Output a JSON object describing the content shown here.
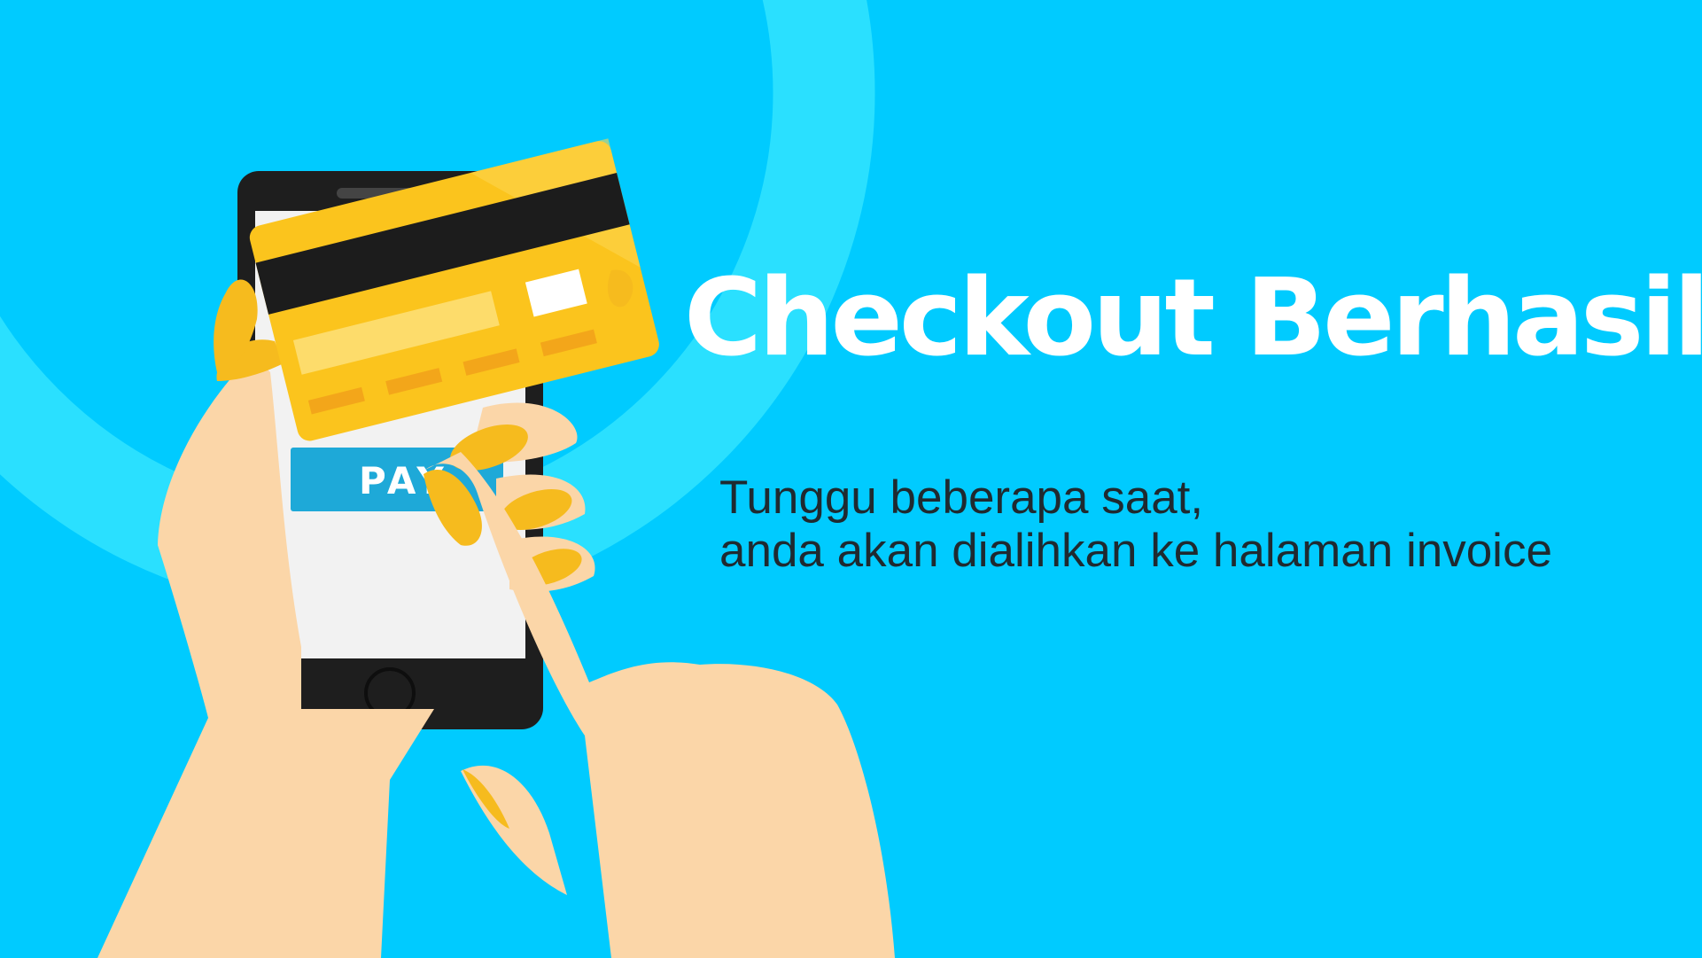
{
  "banner": {
    "title": "Checkout Berhasil",
    "message_line1": "Tunggu beberapa saat,",
    "message_line2": "anda akan dialihkan ke halaman invoice"
  },
  "phone_screen": {
    "pay_button_label": "PAY"
  },
  "colors": {
    "background": "#00cbff",
    "ring": "#2ae0ff",
    "title": "#ffffff",
    "message": "#1f2a30",
    "card": "#fbc41d",
    "card_stripe": "#1c1c1c",
    "phone_body": "#1e1e1e",
    "phone_screen": "#f2f2f2",
    "pay_button": "#1ea9d8",
    "skin": "#fbd6a8",
    "nail": "#f6bb1e"
  },
  "icons": [
    "credit-card-icon",
    "smartphone-icon",
    "hand-icon"
  ]
}
